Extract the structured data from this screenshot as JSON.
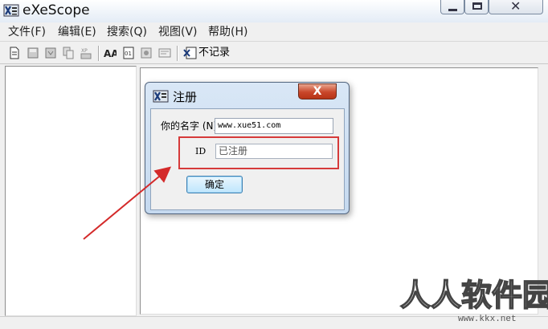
{
  "window": {
    "title": "eXeScope"
  },
  "menu": [
    "文件(F)",
    "编辑(E)",
    "搜索(Q)",
    "视图(V)",
    "帮助(H)"
  ],
  "toolbar": {
    "record_label": "不记录"
  },
  "dialog": {
    "title": "注册",
    "close_glyph": "X",
    "name_label": "你的名字 (N)",
    "name_value": "www.xue51.com",
    "id_label": "ID",
    "id_value": "已注册",
    "ok_label": "确定"
  },
  "watermark": {
    "brand": "人人软件园",
    "url": "www.kkx.net"
  },
  "colors": {
    "highlight": "#d63a3a",
    "arrow": "#d42a2a"
  }
}
